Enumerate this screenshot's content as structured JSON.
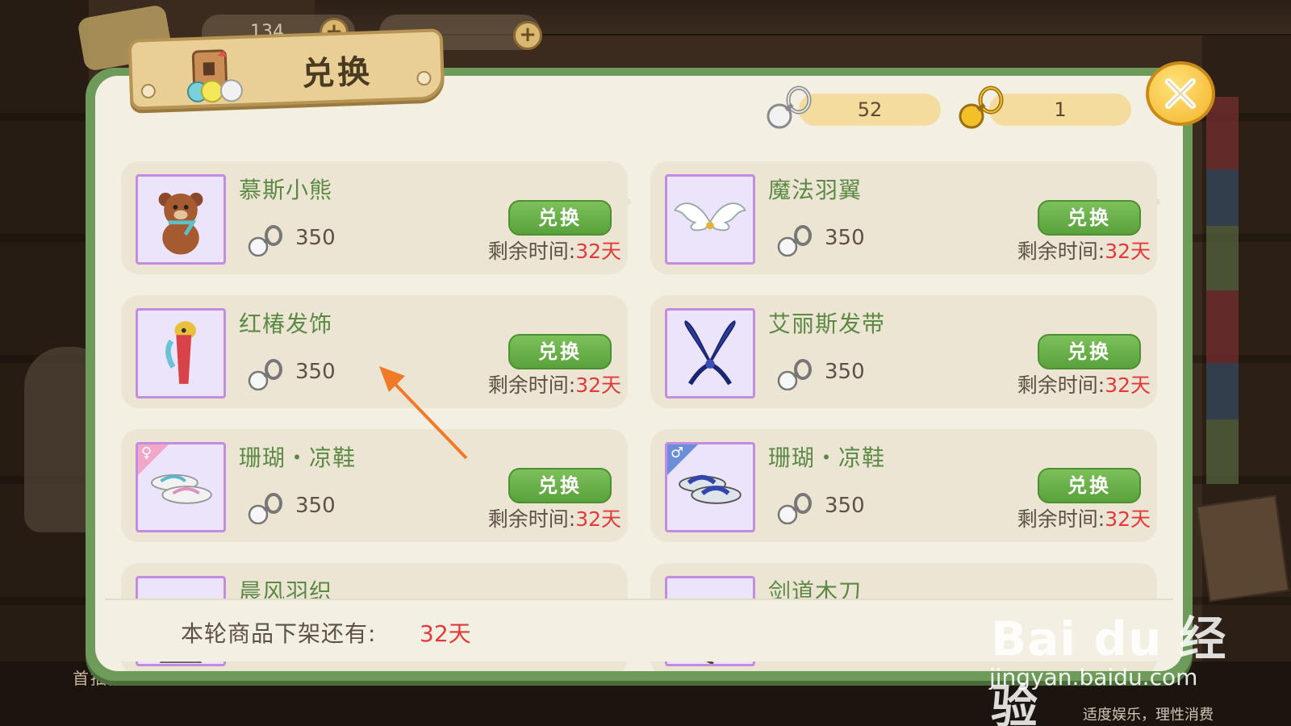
{
  "background": {
    "top_currency_1": "134",
    "first_draw_label": "首抽折扣",
    "bottom_note": "适度娱乐，理性消费"
  },
  "dialog": {
    "title": "兑换",
    "currencies": [
      {
        "icon": "silver-key-coin-icon",
        "value": "52"
      },
      {
        "icon": "gold-key-coin-icon",
        "value": "1"
      }
    ],
    "items": [
      {
        "name": "慕斯小熊",
        "cost": "350",
        "button": "兑换",
        "remain_label": "剩余时间:",
        "remain_value": "32天",
        "icon": "teddy-bear-icon"
      },
      {
        "name": "魔法羽翼",
        "cost": "350",
        "button": "兑换",
        "remain_label": "剩余时间:",
        "remain_value": "32天",
        "icon": "wings-icon"
      },
      {
        "name": "红椿发饰",
        "cost": "350",
        "button": "兑换",
        "remain_label": "剩余时间:",
        "remain_value": "32天",
        "icon": "hair-ornament-icon"
      },
      {
        "name": "艾丽斯发带",
        "cost": "350",
        "button": "兑换",
        "remain_label": "剩余时间:",
        "remain_value": "32天",
        "icon": "ribbon-headband-icon"
      },
      {
        "name": "珊瑚・凉鞋",
        "cost": "350",
        "button": "兑换",
        "remain_label": "剩余时间:",
        "remain_value": "32天",
        "icon": "sandals-female-icon",
        "gender": "♀"
      },
      {
        "name": "珊瑚・凉鞋",
        "cost": "350",
        "button": "兑换",
        "remain_label": "剩余时间:",
        "remain_value": "32天",
        "icon": "sandals-male-icon",
        "gender": "♂"
      },
      {
        "name": "晨风羽织",
        "icon": "haori-icon"
      },
      {
        "name": "剑道木刀",
        "icon": "wooden-sword-icon"
      }
    ],
    "footer_label": "本轮商品下架还有:",
    "footer_value": "32天"
  },
  "watermark": {
    "logo": "Bai du 经验",
    "url": "jingyan.baidu.com"
  },
  "colors": {
    "frame_green": "#6f9b5a",
    "name_green": "#5c8a45",
    "button_green": "#5aa23c",
    "highlight_red": "#e03a3a",
    "thumb_purple": "#c28de0",
    "annotation_orange": "#f07a2a"
  }
}
